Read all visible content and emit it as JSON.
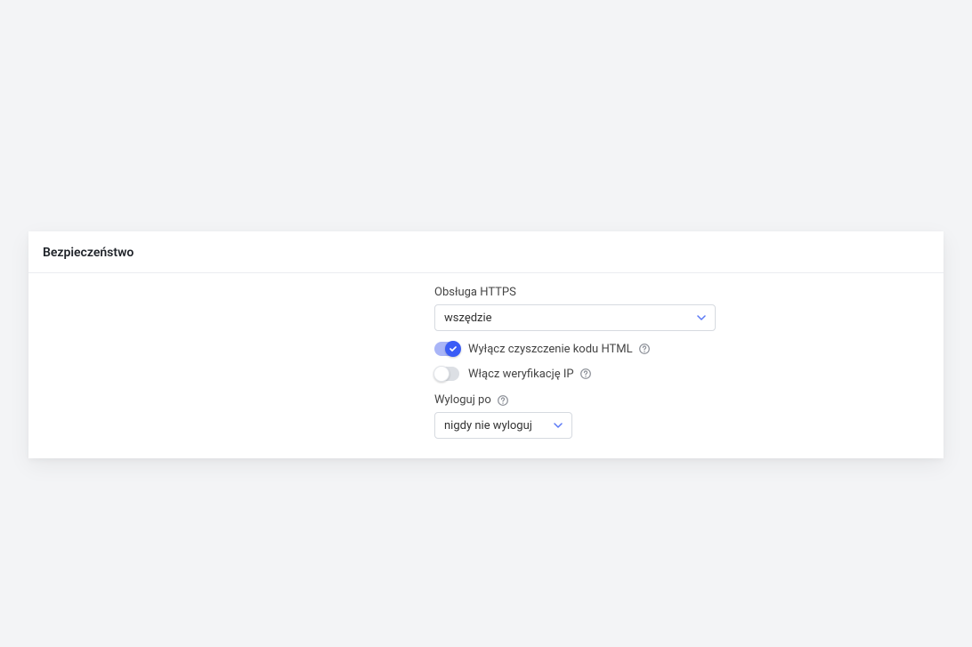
{
  "section": {
    "title": "Bezpieczeństwo"
  },
  "https": {
    "label": "Obsługa HTTPS",
    "value": "wszędzie"
  },
  "toggle_html_clean": {
    "label": "Wyłącz czyszczenie kodu HTML",
    "on": true
  },
  "toggle_ip_verify": {
    "label": "Włącz weryfikację IP",
    "on": false
  },
  "logout": {
    "label": "Wyloguj po",
    "value": "nigdy nie wyloguj"
  }
}
